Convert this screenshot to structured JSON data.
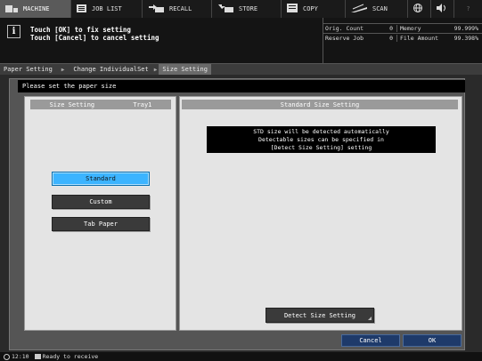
{
  "tabs": [
    {
      "label": "MACHINE",
      "icon": "machine-icon",
      "active": true
    },
    {
      "label": "JOB LIST",
      "icon": "job-list-icon"
    },
    {
      "label": "RECALL",
      "icon": "recall-icon"
    },
    {
      "label": "STORE",
      "icon": "store-icon"
    },
    {
      "label": "COPY",
      "icon": "copy-icon"
    },
    {
      "label": "SCAN",
      "icon": "scan-icon"
    },
    {
      "label": "",
      "icon": "globe-icon"
    },
    {
      "label": "",
      "icon": "volume-icon"
    },
    {
      "label": "?",
      "icon": "help-icon"
    }
  ],
  "message": {
    "line1": "Touch [OK] to fix setting",
    "line2": "Touch [Cancel] to cancel setting"
  },
  "status": {
    "orig_count_label": "Orig. Count",
    "orig_count_value": "0",
    "reserve_job_label": "Reserve Job",
    "reserve_job_value": "0",
    "memory_label": "Memory",
    "memory_value": "99.999%",
    "file_amount_label": "File Amount",
    "file_amount_value": "99.398%"
  },
  "breadcrumb": [
    "Paper Setting",
    "Change IndividualSet",
    "Size Setting"
  ],
  "window": {
    "title": "Please set the paper size",
    "left_header_label": "Size Setting",
    "left_header_tray": "Tray1",
    "right_header": "Standard Size Setting",
    "size_options": [
      "Standard",
      "Custom",
      "Tab Paper"
    ],
    "selected_option": "Standard",
    "notice_line1": "STD size will be detected automatically",
    "notice_line2": "Detectable sizes can be specified in",
    "notice_line3": "[Detect Size Setting] setting",
    "detect_button": "Detect Size Setting",
    "cancel_button": "Cancel",
    "ok_button": "OK"
  },
  "statusbar": {
    "time": "12:10",
    "text": "Ready to receive"
  },
  "colors": {
    "selected_button": "#3cb4ff",
    "action_button": "#1e3a6a",
    "pane_bg": "#e4e4e4"
  }
}
